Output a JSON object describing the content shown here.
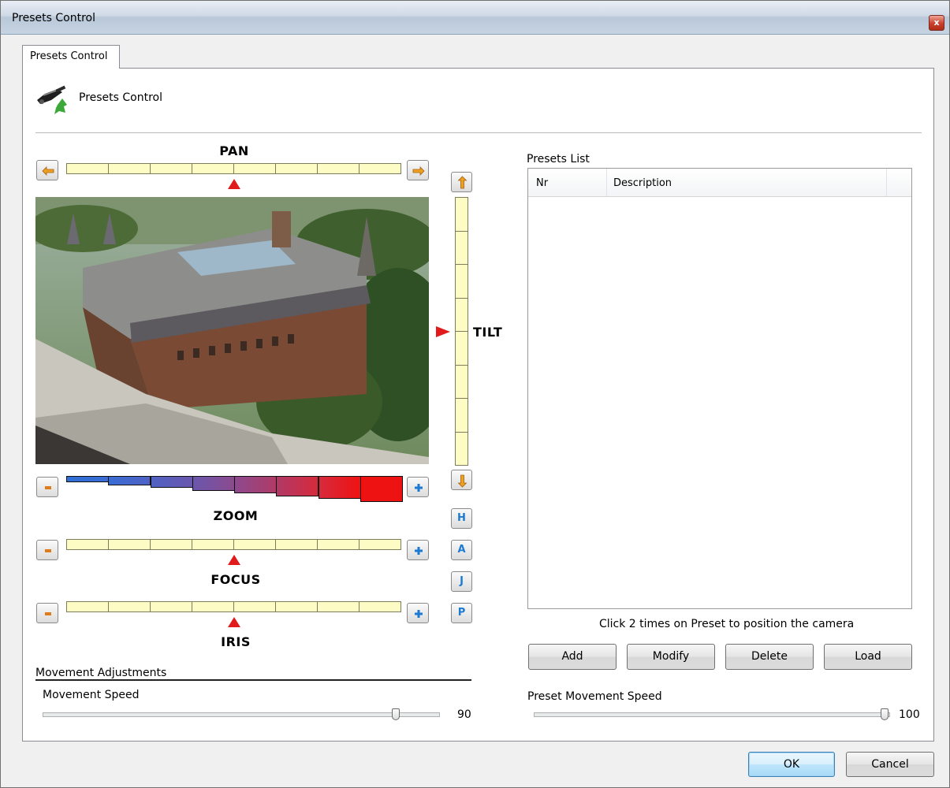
{
  "window": {
    "title": "Presets Control",
    "close_glyph": "x"
  },
  "tabs": [
    {
      "label": "Presets Control"
    }
  ],
  "header": {
    "label": "Presets Control",
    "icon": "ptz-camera-icon"
  },
  "controls": {
    "pan": {
      "label": "PAN",
      "position": 0.5,
      "left_icon": "arrow-left-icon",
      "right_icon": "arrow-right-icon"
    },
    "tilt": {
      "label": "TILT",
      "position": 0.5,
      "up_icon": "arrow-up-icon",
      "down_icon": "arrow-down-icon"
    },
    "zoom": {
      "label": "ZOOM",
      "minus_icon": "minus-icon",
      "plus_icon": "plus-icon",
      "level_colors": [
        "#2f6fd6",
        "#3a6cd4",
        "#4f62c5",
        "#6a57ad",
        "#8c4a8e",
        "#b03a66",
        "#d62a3c",
        "#ef1212"
      ]
    },
    "focus": {
      "label": "FOCUS",
      "position": 0.5
    },
    "iris": {
      "label": "IRIS",
      "position": 0.5
    },
    "side_buttons": [
      "H",
      "A",
      "J",
      "P"
    ]
  },
  "movement": {
    "group_label": "Movement Adjustments",
    "speed_label": "Movement Speed",
    "speed_value": "90",
    "speed_fraction": 0.9
  },
  "presets": {
    "group_label": "Presets List",
    "columns": [
      "Nr",
      "Description"
    ],
    "rows": [],
    "hint": "Click 2 times on Preset to position the camera",
    "buttons": {
      "add": "Add",
      "modify": "Modify",
      "delete": "Delete",
      "load": "Load"
    },
    "speed_label": "Preset Movement Speed",
    "speed_value": "100",
    "speed_fraction": 1.0
  },
  "footer": {
    "ok": "OK",
    "cancel": "Cancel"
  },
  "colors": {
    "accent": "#e11b1b",
    "track": "#fdfcc4",
    "side_letter": "#1c7ad0"
  }
}
